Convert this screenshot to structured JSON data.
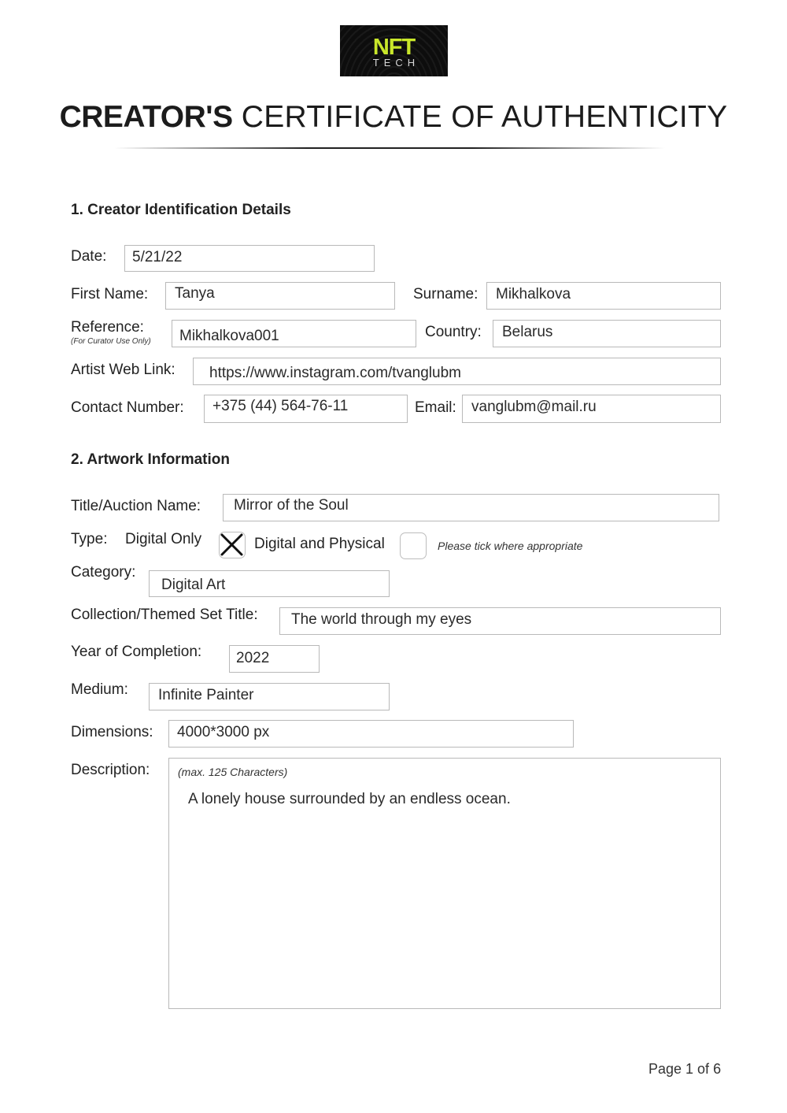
{
  "logo": {
    "primary": "NFT",
    "secondary": "TECH",
    "accent_color": "#c9e72a"
  },
  "title": {
    "bold": "CREATOR'S",
    "rest": "CERTIFICATE OF AUTHENTICITY"
  },
  "section1": {
    "heading": "1. Creator Identification Details",
    "date": {
      "label": "Date:",
      "value": "5/21/22"
    },
    "first_name": {
      "label": "First Name:",
      "value": "Tanya"
    },
    "surname": {
      "label": "Surname:",
      "value": "Mikhalkova"
    },
    "reference": {
      "label": "Reference:",
      "sublabel": "(For Curator Use Only)",
      "value": "Mikhalkova001"
    },
    "country": {
      "label": "Country:",
      "value": "Belarus"
    },
    "web_link": {
      "label": "Artist Web Link:",
      "value": "https://www.instagram.com/tvanglubm"
    },
    "contact": {
      "label": "Contact Number:",
      "value": "+375 (44) 564-76-11"
    },
    "email": {
      "label": "Email:",
      "value": "vanglubm@mail.ru"
    }
  },
  "section2": {
    "heading": "2. Artwork Information",
    "title": {
      "label": "Title/Auction Name:",
      "value": "Mirror of the Soul"
    },
    "type": {
      "label": "Type:",
      "options": [
        {
          "label": "Digital Only",
          "checked": true
        },
        {
          "label": "Digital and Physical",
          "checked": false
        }
      ],
      "note": "Please tick where appropriate"
    },
    "category": {
      "label": "Category:",
      "value": "Digital Art"
    },
    "collection": {
      "label": "Collection/Themed Set Title:",
      "value": "The world through my eyes"
    },
    "year": {
      "label": "Year of Completion:",
      "value": "2022"
    },
    "medium": {
      "label": "Medium:",
      "value": "Infinite Painter"
    },
    "dimensions": {
      "label": "Dimensions:",
      "value": "4000*3000 px"
    },
    "description": {
      "label": "Description:",
      "hint": "(max. 125 Characters)",
      "value": "A lonely house surrounded by an endless ocean."
    }
  },
  "footer": {
    "page": "Page 1 of 6"
  }
}
